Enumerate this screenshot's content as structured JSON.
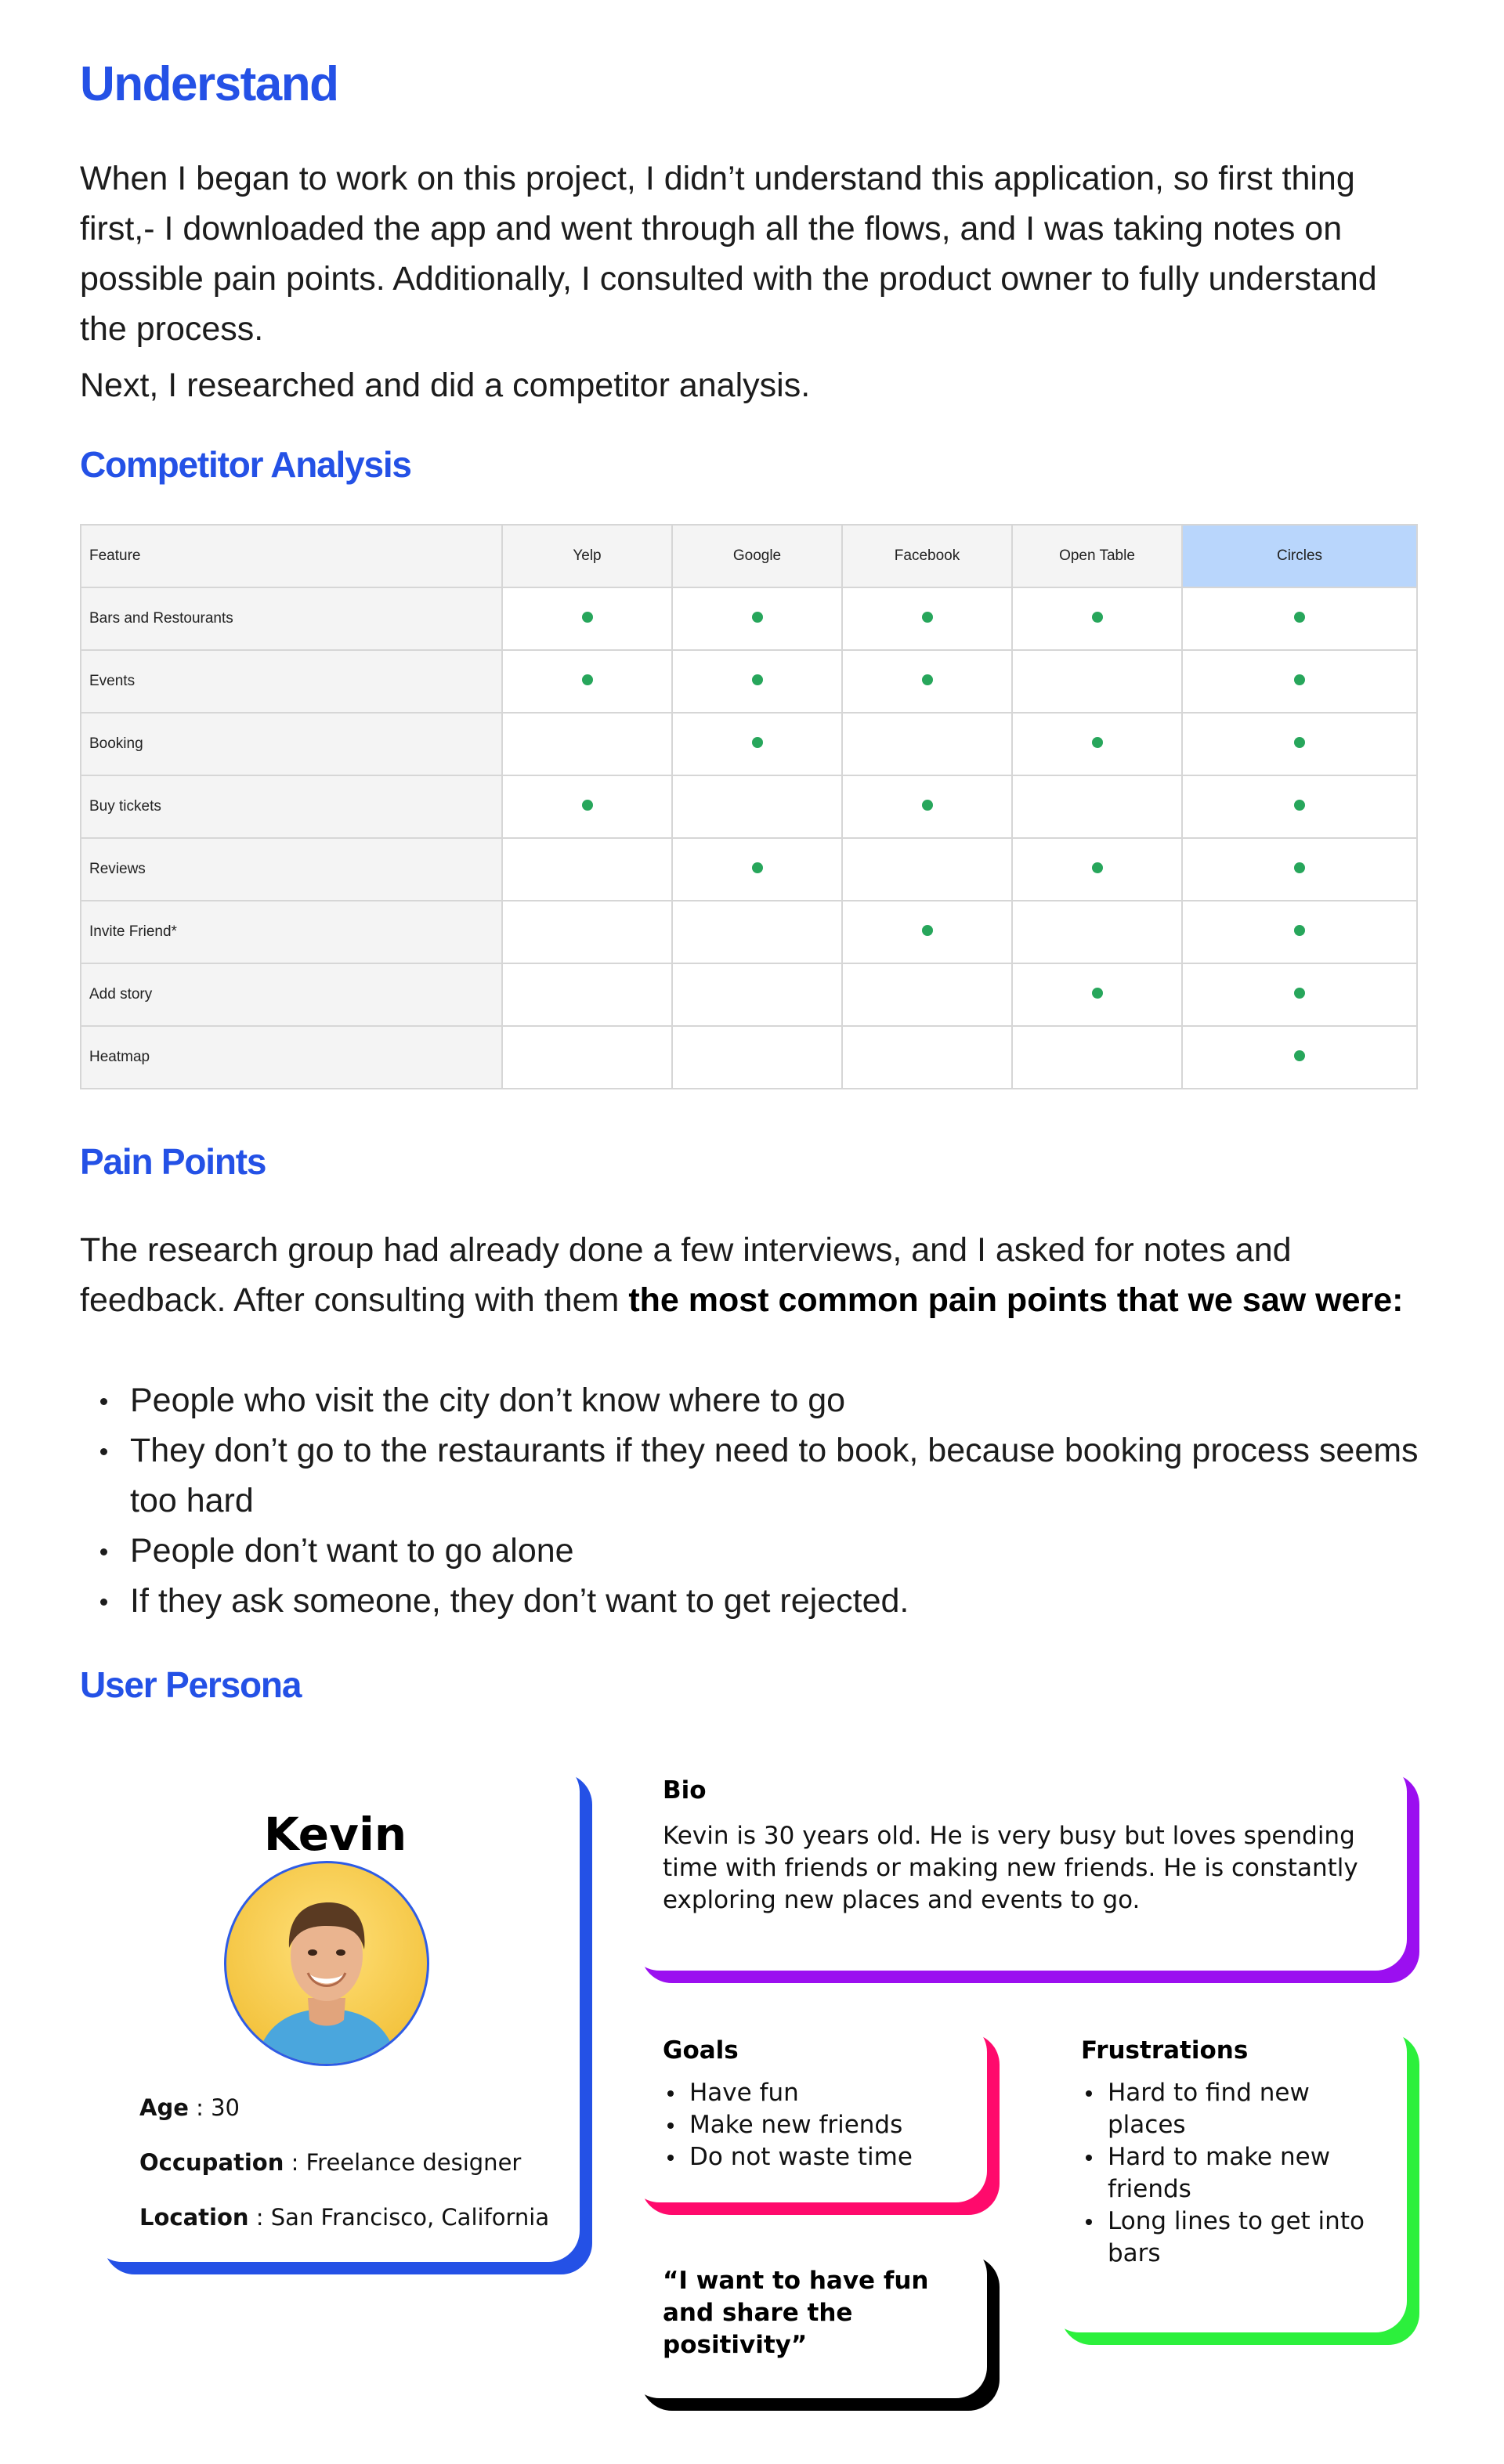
{
  "sections": {
    "understand_title": "Understand",
    "competitor_title": "Competitor Analysis",
    "pain_title": "Pain Points",
    "persona_title": "User Persona"
  },
  "understand": {
    "paragraph1": "When I began to work on this project, I didn’t understand this application, so first thing first,- I downloaded the app and went through all the flows, and I was taking notes on possible pain points. Additionally, I consulted with the product owner to fully understand the process.",
    "paragraph2": "Next, I researched and did a competitor analysis."
  },
  "table": {
    "headers": [
      "Feature",
      "Yelp",
      "Google",
      "Facebook",
      "Open Table",
      "Circles"
    ],
    "highlight_column": "Circles",
    "highlight_color": "#b9d6fc",
    "dot_color": "#27a65b",
    "rows": [
      {
        "feature": "Bars and Restourants",
        "checks": [
          true,
          true,
          true,
          true,
          true
        ]
      },
      {
        "feature": "Events",
        "checks": [
          true,
          true,
          true,
          false,
          true
        ]
      },
      {
        "feature": "Booking",
        "checks": [
          false,
          true,
          false,
          true,
          true
        ]
      },
      {
        "feature": "Buy tickets",
        "checks": [
          true,
          false,
          true,
          false,
          true
        ]
      },
      {
        "feature": "Reviews",
        "checks": [
          false,
          true,
          false,
          true,
          true
        ]
      },
      {
        "feature": "Invite Friend*",
        "checks": [
          false,
          false,
          true,
          false,
          true
        ]
      },
      {
        "feature": "Add story",
        "checks": [
          false,
          false,
          false,
          true,
          true
        ]
      },
      {
        "feature": "Heatmap",
        "checks": [
          false,
          false,
          false,
          false,
          true
        ]
      }
    ]
  },
  "pain_points": {
    "intro_start": "The research group had already done a few interviews, and I asked for notes and feedback. After consulting with them ",
    "intro_bold": "the most common pain points that we saw were:",
    "items": [
      "People who visit the city don’t know where to go",
      "They don’t go to the restaurants if they need to book, because booking process seems too hard",
      "People don’t want to go alone",
      "If they ask someone, they don’t want to get rejected."
    ]
  },
  "persona": {
    "name": "Kevin",
    "age_label": "Age",
    "age": "30",
    "occupation_label": "Occupation",
    "occupation": "Freelance designer",
    "location_label": "Location",
    "location": "San Francisco, California",
    "bio_title": "Bio",
    "bio": "Kevin is 30 years old. He is very busy but loves spending time with friends or making new friends. He is constantly exploring new places and events to go.",
    "goals_title": "Goals",
    "goals": [
      "Have fun",
      "Make new friends",
      "Do not waste time"
    ],
    "frustrations_title": "Frustrations",
    "frustrations": [
      "Hard to find new places",
      "Hard to make new friends",
      "Long lines to get into bars"
    ],
    "quote": "“I want to have fun and share the positivity”",
    "colors": {
      "profile": "#2451e6",
      "bio": "#9b0ff0",
      "goals": "#ff0a6c",
      "frustrations": "#2cf03c",
      "quote": "#000000"
    }
  }
}
